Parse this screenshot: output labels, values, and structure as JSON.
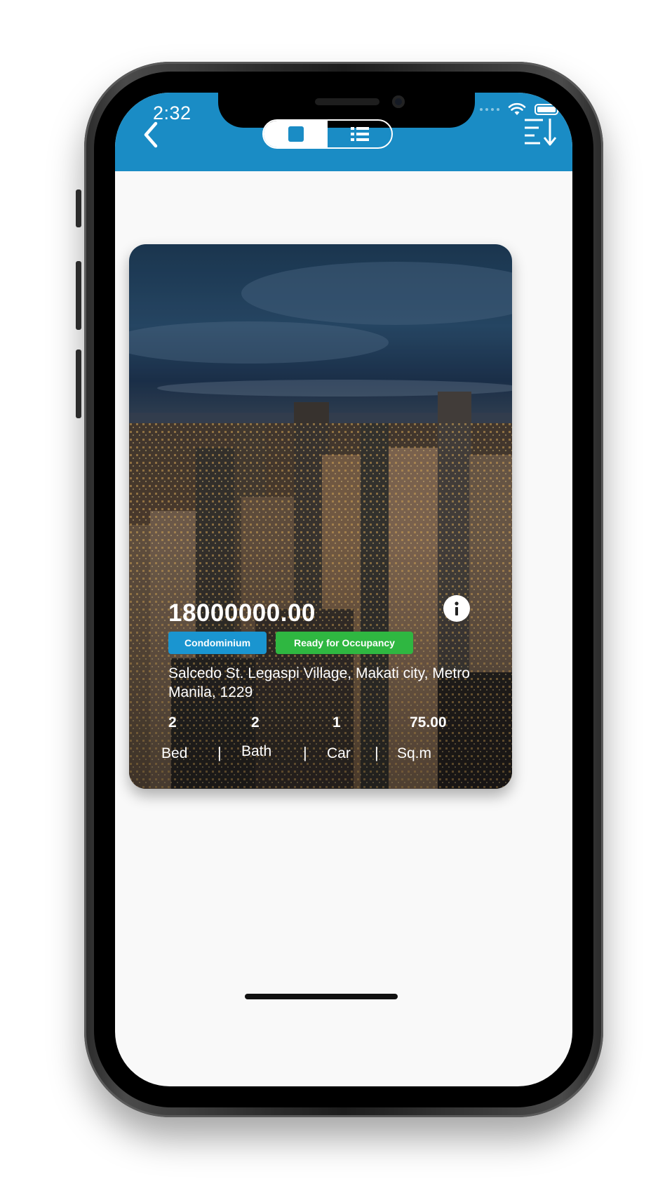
{
  "status_bar": {
    "time": "2:32"
  },
  "header": {
    "back_icon": "chevron-left-icon",
    "toggle": {
      "grid_icon": "square-icon",
      "list_icon": "list-icon",
      "active": "grid"
    },
    "sort_icon": "sort-descending-icon",
    "color": "#1a8cc5"
  },
  "card": {
    "price": "18000000.00",
    "type_badge": "Condominium",
    "status_badge": "Ready for Occupancy",
    "address": "Salcedo St. Legaspi Village, Makati city, Metro Manila, 1229",
    "specs": [
      {
        "value": "2",
        "label": "Bed"
      },
      {
        "value": "2",
        "label": "Bath"
      },
      {
        "value": "1",
        "label": "Car"
      },
      {
        "value": "75.00",
        "label": "Sq.m"
      }
    ],
    "separator": "|",
    "info_icon": "info-icon",
    "badge_colors": {
      "type": "#1a95d0",
      "status": "#2fb741"
    }
  }
}
